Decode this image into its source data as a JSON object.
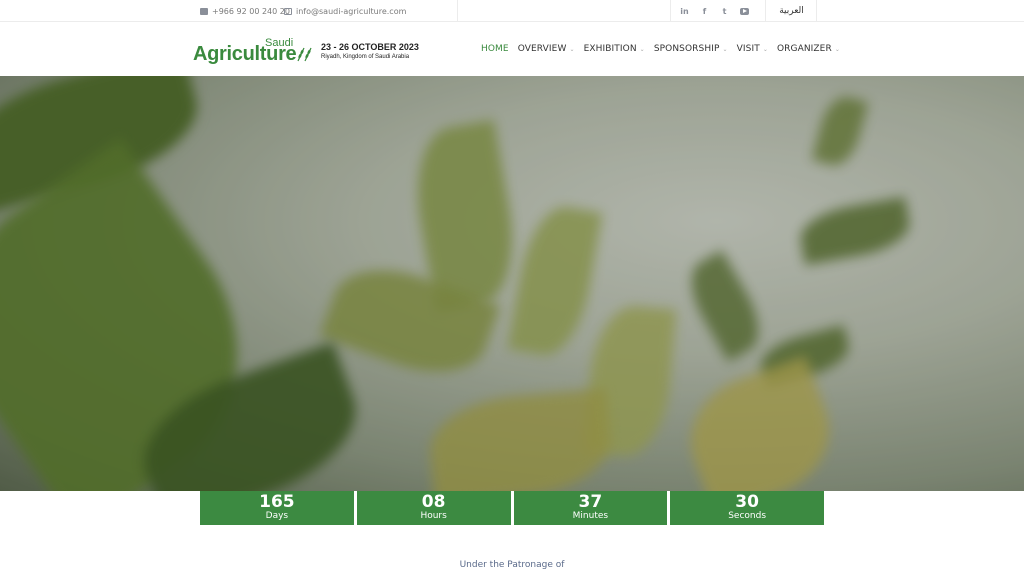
{
  "topbar": {
    "phone": "+966 92 00 240 20",
    "email": "info@saudi-agriculture.com",
    "socials": [
      {
        "icon": "linkedin-icon",
        "glyph": "in"
      },
      {
        "icon": "facebook-icon",
        "glyph": "f"
      },
      {
        "icon": "twitter-icon",
        "glyph": "t"
      },
      {
        "icon": "youtube-icon",
        "glyph": ""
      }
    ],
    "language": "العربية"
  },
  "logo": {
    "saudi": "Saudi",
    "agriculture": "Agriculture",
    "dates": "23 - 26 OCTOBER 2023",
    "place": "Riyadh, Kingdom of Saudi Arabia"
  },
  "nav": {
    "home": "HOME",
    "overview": "OVERVIEW",
    "exhibition": "EXHIBITION",
    "sponsorship": "SPONSORSHIP",
    "visit": "VISIT",
    "organizer": "ORGANIZER"
  },
  "countdown": {
    "days_value": "165",
    "days_label": "Days",
    "hours_value": "08",
    "hours_label": "Hours",
    "minutes_value": "37",
    "minutes_label": "Minutes",
    "seconds_value": "30",
    "seconds_label": "Seconds"
  },
  "patronage": "Under the Patronage of",
  "colors": {
    "brand_green": "#3c8a41",
    "text_muted": "#7a7a7a"
  }
}
